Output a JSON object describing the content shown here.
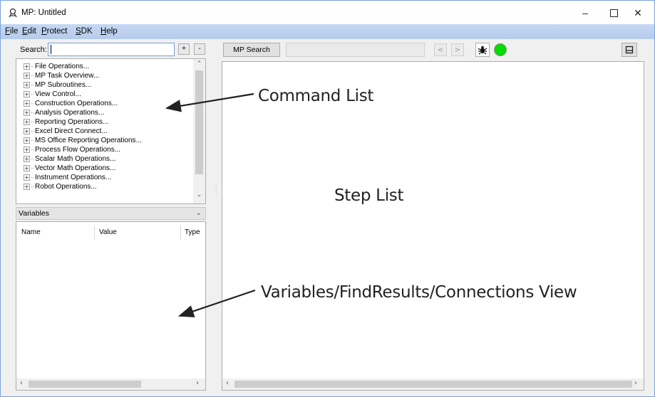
{
  "window": {
    "title": "MP: Untitled",
    "min_glyph": "–",
    "max_glyph": "☐",
    "close_glyph": "✕"
  },
  "menu": [
    "File",
    "Edit",
    "Protect",
    "SDK",
    "Help"
  ],
  "search": {
    "label": "Search:",
    "value": "",
    "plus_label": "+",
    "minus_label": "-"
  },
  "command_tree": {
    "items": [
      "File Operations...",
      "MP Task Overview...",
      "MP Subroutines...",
      "View Control...",
      "Construction Operations...",
      "Analysis Operations...",
      "Reporting Operations...",
      "Excel Direct Connect...",
      "MS Office Reporting Operations...",
      "Process Flow Operations...",
      "Scalar Math Operations...",
      "Vector Math Operations...",
      "Instrument Operations...",
      "Robot Operations..."
    ],
    "expander_glyph": "+"
  },
  "variables": {
    "dropdown_label": "Variables",
    "columns": [
      "Name",
      "Value",
      "Type"
    ]
  },
  "toolbar": {
    "mp_search_label": "MP Search",
    "back_glyph": "<",
    "forward_glyph": ">",
    "debug_icon": "bug-icon",
    "status_color": "#00dd00"
  },
  "annotations": {
    "command_list": "Command List",
    "step_list": "Step List",
    "variables_view": "Variables/FindResults/Connections View"
  },
  "colors": {
    "menubar": "#c5d7f2",
    "window_border": "#7aa2d4"
  }
}
